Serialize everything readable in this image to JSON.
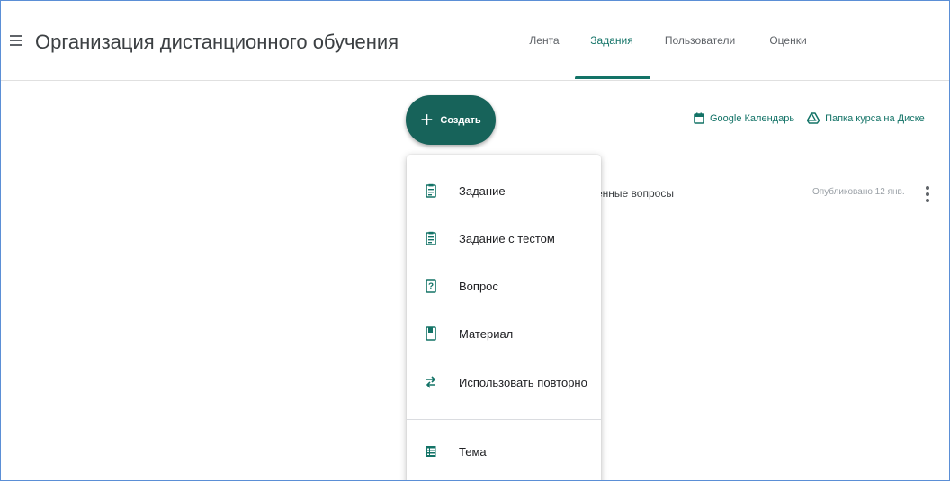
{
  "header": {
    "title": "Организация дистанционного обучения",
    "tabs": [
      {
        "label": "Лента",
        "active": false
      },
      {
        "label": "Задания",
        "active": true
      },
      {
        "label": "Пользователи",
        "active": false
      },
      {
        "label": "Оценки",
        "active": false
      }
    ]
  },
  "toolbar": {
    "create_label": "Создать",
    "calendar_link": "Google Календарь",
    "drive_link": "Папка курса на Диске"
  },
  "post": {
    "title_fragment": "енные вопросы",
    "published": "Опубликовано 12 янв."
  },
  "create_menu": {
    "items": [
      {
        "label": "Задание",
        "icon": "assignment-icon"
      },
      {
        "label": "Задание с тестом",
        "icon": "quiz-assignment-icon"
      },
      {
        "label": "Вопрос",
        "icon": "question-icon"
      },
      {
        "label": "Материал",
        "icon": "material-icon"
      },
      {
        "label": "Использовать повторно",
        "icon": "reuse-icon"
      },
      {
        "label": "Тема",
        "icon": "topic-icon"
      }
    ]
  },
  "colors": {
    "accent": "#137367",
    "create_button": "#17635a",
    "text": "#3c4043",
    "muted": "#9aa0a6"
  }
}
